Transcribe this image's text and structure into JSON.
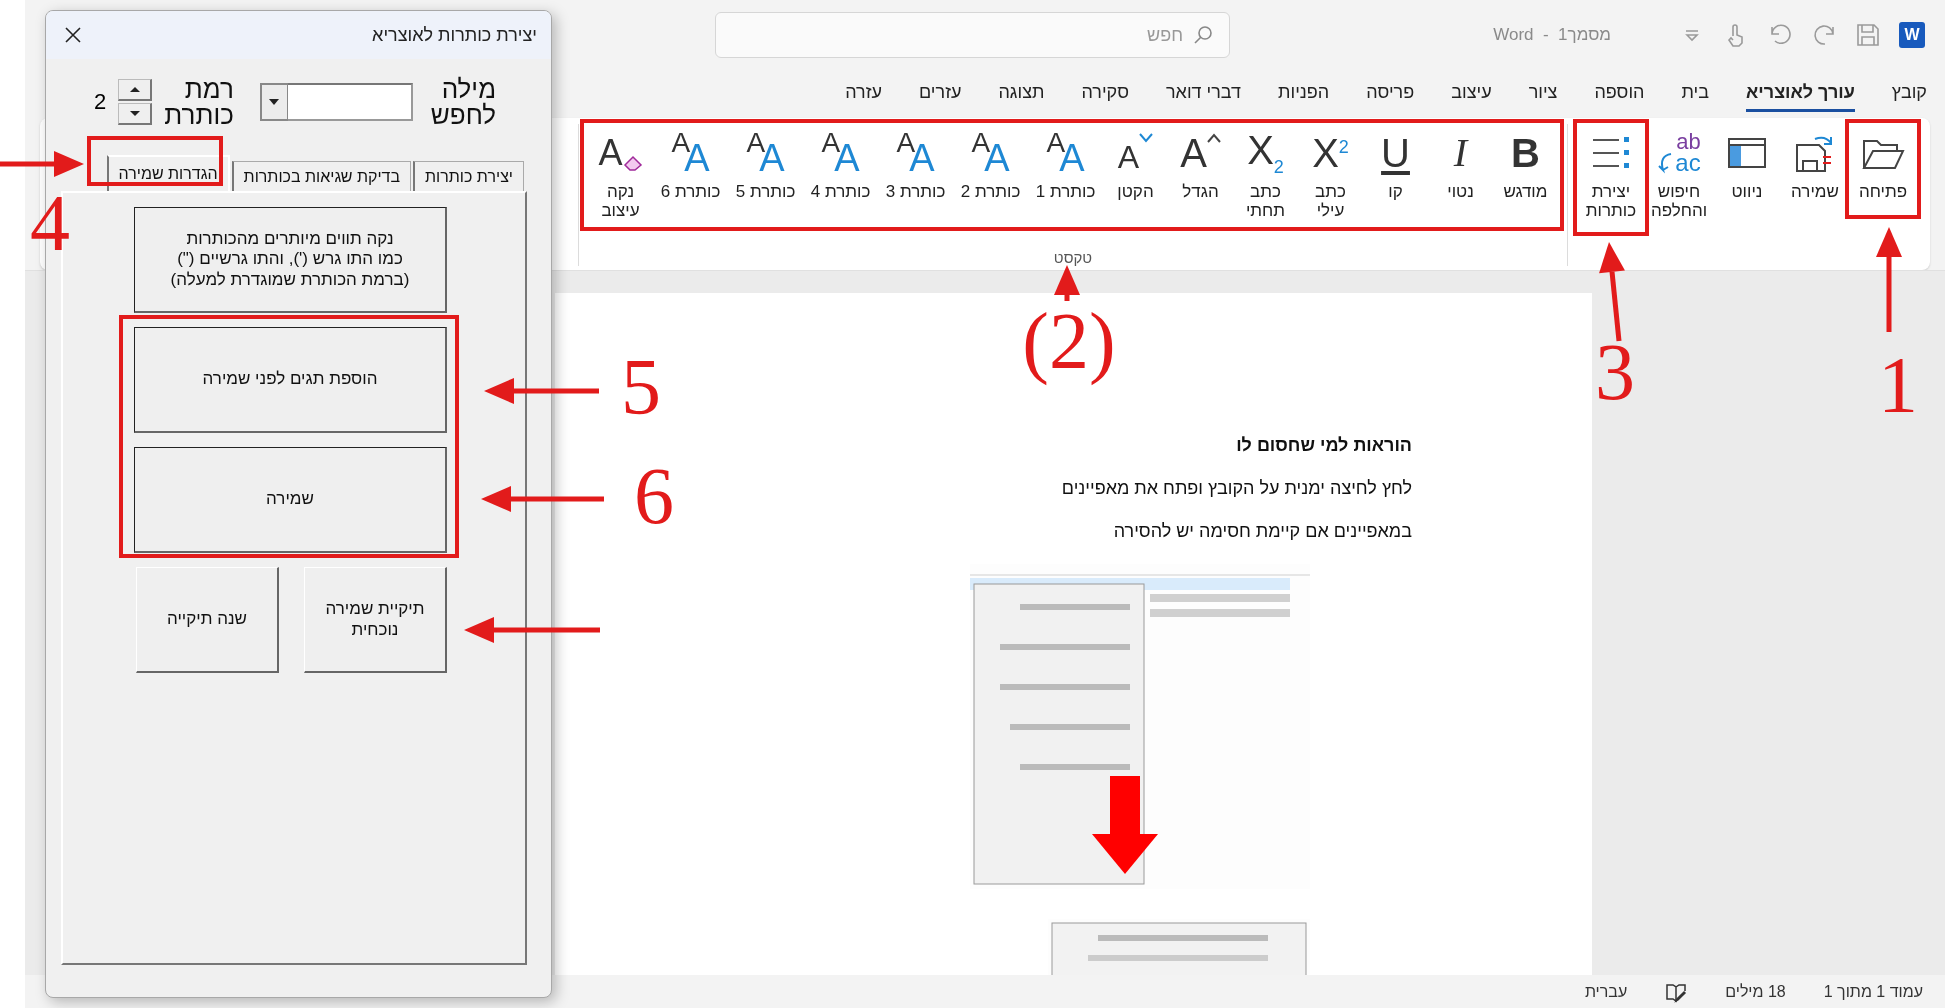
{
  "window": {
    "logo_letter": "W",
    "title": "מסמך1  -  Word",
    "search": {
      "placeholder": "חפש"
    }
  },
  "ribbon_tabs": [
    {
      "label": "קובץ",
      "selected": false
    },
    {
      "label": "עורך לאוצריא",
      "selected": true
    },
    {
      "label": "בית",
      "selected": false
    },
    {
      "label": "הוספה",
      "selected": false
    },
    {
      "label": "ציור",
      "selected": false
    },
    {
      "label": "עיצוב",
      "selected": false
    },
    {
      "label": "פריסה",
      "selected": false
    },
    {
      "label": "הפניות",
      "selected": false
    },
    {
      "label": "דברי דואר",
      "selected": false
    },
    {
      "label": "סקירה",
      "selected": false
    },
    {
      "label": "תצוגה",
      "selected": false
    },
    {
      "label": "עזרים",
      "selected": false
    },
    {
      "label": "עזרה",
      "selected": false
    }
  ],
  "ribbon_groups": [
    {
      "buttons": [
        {
          "kind": "open",
          "label": "פתיחה"
        },
        {
          "kind": "save",
          "label": "שמירה"
        },
        {
          "kind": "navigate",
          "label": "ניווט"
        },
        {
          "kind": "replace",
          "label": "חיפוש\nוהחלפה",
          "glyphs": [
            "ab",
            "ac"
          ]
        },
        {
          "kind": "headings",
          "label": "יצירת\nכותרות"
        }
      ]
    },
    {
      "label": "טקסט",
      "buttons": [
        {
          "kind": "bold",
          "label": "מודגש",
          "glyphs": [
            "B"
          ]
        },
        {
          "kind": "italic",
          "label": "נטוי",
          "glyphs": [
            "I"
          ]
        },
        {
          "kind": "underline",
          "label": "קו",
          "glyphs": [
            "U"
          ]
        },
        {
          "kind": "script",
          "label": "כתב\nעילי",
          "glyphs": [
            "X$^{2}$"
          ]
        },
        {
          "kind": "script",
          "label": "כתב\nתחתי",
          "glyphs": [
            "X$_{2}$"
          ]
        },
        {
          "kind": "grow",
          "label": "הגדל",
          "glyphs": [
            "A"
          ]
        },
        {
          "kind": "shrink",
          "label": "הקטן",
          "glyphs": [
            "A"
          ]
        },
        {
          "kind": "heading",
          "label": "כותרת 1",
          "glyphs": [
            "A",
            "A"
          ]
        },
        {
          "kind": "heading",
          "label": "כותרת 2",
          "glyphs": [
            "A",
            "A"
          ]
        },
        {
          "kind": "heading",
          "label": "כותרת 3",
          "glyphs": [
            "A",
            "A"
          ]
        },
        {
          "kind": "heading",
          "label": "כותרת 4",
          "glyphs": [
            "A",
            "A"
          ]
        },
        {
          "kind": "heading",
          "label": "כותרת 5",
          "glyphs": [
            "A",
            "A"
          ]
        },
        {
          "kind": "heading",
          "label": "כותרת 6",
          "glyphs": [
            "A",
            "A"
          ]
        },
        {
          "kind": "clear",
          "label": "נקה\nעיצוב",
          "glyphs": [
            "A"
          ]
        }
      ]
    }
  ],
  "document": {
    "heading": "הוראות למי שחסום לו",
    "paragraphs": [
      "לחץ לחיצה ימנית על הקובץ ופתח את מאפיינים",
      "במאפיינים אם קיימת חסימה יש להסירה"
    ],
    "images": [
      {
        "kind": "picture"
      },
      {
        "kind": "picture"
      }
    ]
  },
  "status_bar": {
    "page": "עמוד 1 מתוך 1",
    "words": "18 מילים",
    "language": "עברית"
  },
  "dialog": {
    "title": "יצירת כותרות לאוצריא",
    "search_label": "מילה\nלחפש",
    "level_label": "רמת\nכותרת",
    "level_value": "2",
    "tabs": [
      {
        "label": "יצירת כותרות",
        "selected": false
      },
      {
        "label": "בדיקת שגיאות בכותרות",
        "selected": false
      },
      {
        "label": "הגדרות שמירה",
        "selected": true
      }
    ],
    "buttons": [
      {
        "kind": "wide",
        "label": "נקה תווים מיותרים מהכותרות\nכמו התו גרש ('), והתו גרשיים (\")\n(ברמת הכותרת שמוגדרת למעלה)"
      },
      {
        "kind": "wide",
        "label": "הוספת תגים לפני שמירה"
      },
      {
        "kind": "wide",
        "label": "שמירה"
      },
      {
        "kind": "half",
        "label": "תיקיית שמירה\nנוכחית"
      },
      {
        "kind": "half",
        "label": "שנה תיקייה"
      }
    ]
  },
  "callouts": [
    "4",
    "1",
    "3",
    "(2)",
    "5",
    "6"
  ]
}
